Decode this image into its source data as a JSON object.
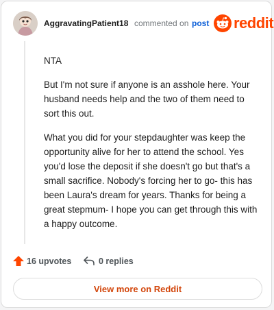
{
  "comment": {
    "username": "AggravatingPatient18",
    "action_text": "commented on",
    "post_link": "post",
    "brand": "reddit",
    "paragraphs": [
      "NTA",
      "But I'm not sure if anyone is an asshole here. Your husband needs help and the two of them need to sort this out.",
      "What you did for your stepdaughter was keep the opportunity alive for her to attend the school. Yes you'd lose the deposit if she doesn't go but that's a small sacrifice. Nobody's forcing her to go- this has been Laura's dream for years. Thanks for being a great stepmum- I hope you can get through this with a happy outcome."
    ]
  },
  "footer": {
    "upvotes": "16 upvotes",
    "replies": "0 replies",
    "view_more": "View more on Reddit"
  },
  "icons": {
    "avatar": "avatar-icon",
    "reddit_logo": "reddit-logo-icon",
    "upvote": "upvote-arrow-icon",
    "reply": "reply-arrow-icon"
  },
  "colors": {
    "brand": "#ff4500",
    "link": "#0b5ed7",
    "view_more_text": "#d2450a",
    "muted": "#707579"
  }
}
